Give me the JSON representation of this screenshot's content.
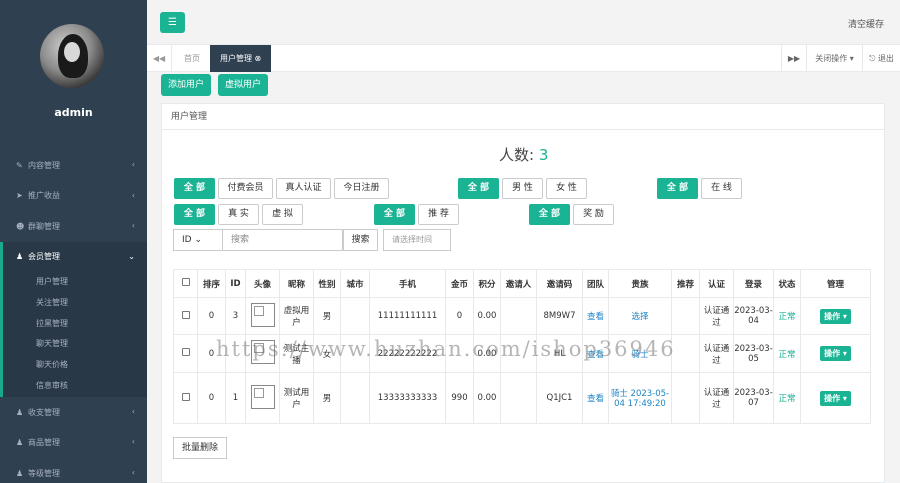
{
  "sidebar": {
    "user": "admin",
    "items": [
      {
        "icon": "✎",
        "label": "内容管理"
      },
      {
        "icon": "➤",
        "label": "推广收益"
      },
      {
        "icon": "☻",
        "label": "群聊管理"
      },
      {
        "icon": "♟",
        "label": "会员管理"
      }
    ],
    "sub_items": [
      "用户管理",
      "关注管理",
      "拉黑管理",
      "聊天管理",
      "聊天价格",
      "信息审核"
    ],
    "items_after": [
      {
        "icon": "♟",
        "label": "收支管理"
      },
      {
        "icon": "♟",
        "label": "商品管理"
      },
      {
        "icon": "♟",
        "label": "等级管理"
      }
    ]
  },
  "topbar": {
    "clear_cache": "清空缓存"
  },
  "tabs": {
    "home": "首页",
    "current": "用户管理",
    "close_ops": "关闭操作",
    "logout": "退出"
  },
  "actions": {
    "add_user": "添加用户",
    "virtual_user": "虚拟用户"
  },
  "panel": {
    "title": "用户管理",
    "count_label": "人数:",
    "count_value": "3"
  },
  "filters": {
    "all": "全 部",
    "pay": "付费会员",
    "real_auth": "真人认证",
    "today_reg": "今日注册",
    "male": "男 性",
    "female": "女 性",
    "online": "在 线",
    "real": "真 实",
    "virtual": "虚 拟",
    "recommend": "推 荐",
    "reward": "奖 励"
  },
  "search": {
    "field": "ID",
    "placeholder": "搜索",
    "button": "搜索",
    "date_placeholder": "请选择时间"
  },
  "table": {
    "headers": [
      "",
      "排序",
      "ID",
      "头像",
      "昵称",
      "性别",
      "城市",
      "手机",
      "金币",
      "积分",
      "邀请人",
      "邀请码",
      "团队",
      "贵族",
      "推荐",
      "认证",
      "登录",
      "状态",
      "管理"
    ],
    "rows": [
      {
        "sort": "0",
        "id": "3",
        "nick": "虚拟用户",
        "gender": "男",
        "city": "",
        "phone": "11111111111",
        "gold": "0",
        "points": "0.00",
        "inviter": "",
        "code": "8M9W7",
        "team": "查看",
        "noble": "选择",
        "recommend": "",
        "auth": "认证通过",
        "login": "2023-03-04",
        "status": "正常",
        "op": "操作"
      },
      {
        "sort": "0",
        "id": "",
        "nick": "测试主播",
        "gender": "女",
        "city": "",
        "phone": "22222222222",
        "gold": "",
        "points": "0.00",
        "inviter": "",
        "code": "HL",
        "team": "查看",
        "noble": "骑士",
        "recommend": "",
        "auth": "认证通过",
        "login": "2023-03-05",
        "status": "正常",
        "op": "操作"
      },
      {
        "sort": "0",
        "id": "1",
        "nick": "测试用户",
        "gender": "男",
        "city": "",
        "phone": "13333333333",
        "gold": "990",
        "points": "0.00",
        "inviter": "",
        "code": "Q1JC1",
        "team": "查看",
        "noble": "骑士 2023-05-04 17:49:20",
        "recommend": "",
        "auth": "认证通过",
        "login": "2023-03-07",
        "status": "正常",
        "op": "操作"
      }
    ]
  },
  "batch_delete": "批量删除",
  "watermark": "https://www.huzhan.com/ishop36946"
}
